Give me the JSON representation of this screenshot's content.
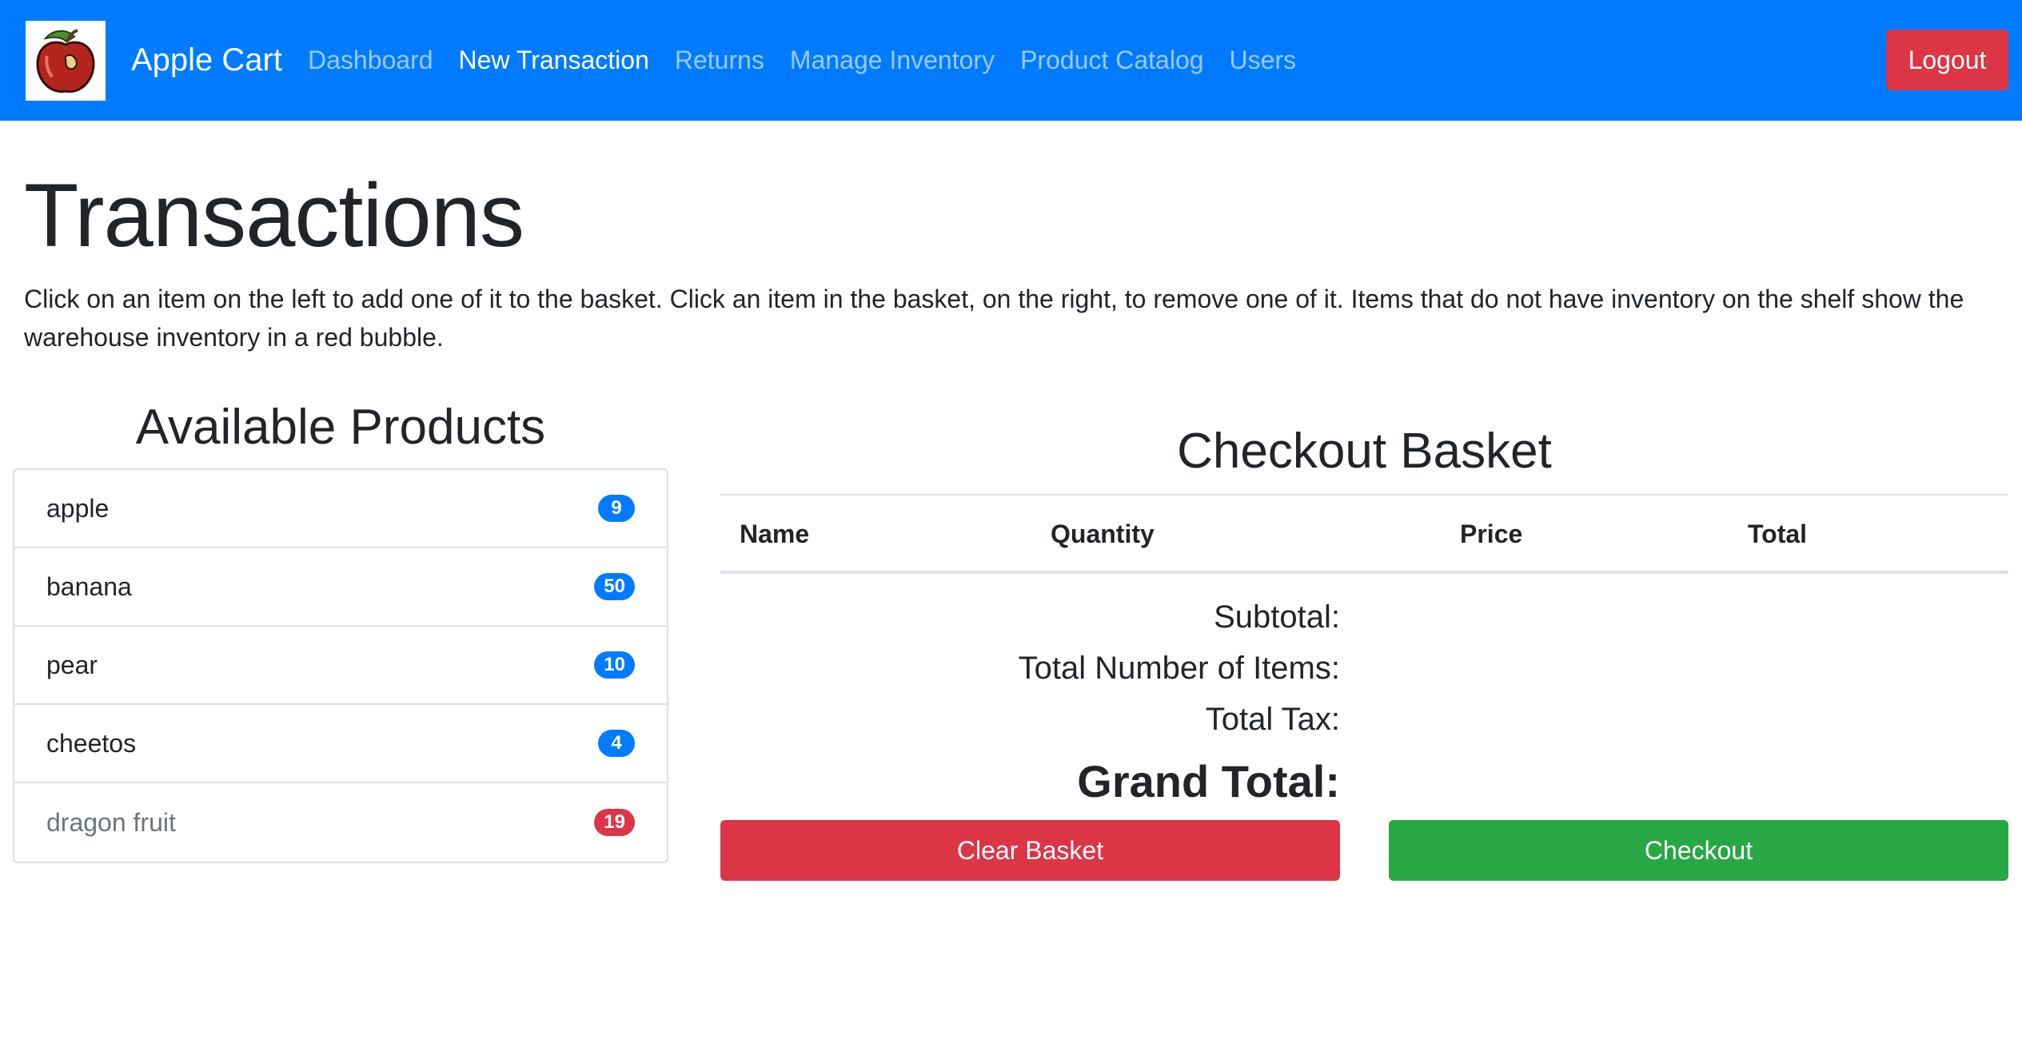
{
  "navbar": {
    "brand": "Apple Cart",
    "links": [
      "Dashboard",
      "New Transaction",
      "Returns",
      "Manage Inventory",
      "Product Catalog",
      "Users"
    ],
    "active": "New Transaction",
    "logout": "Logout",
    "color": "#007bff"
  },
  "page": {
    "title": "Transactions",
    "description": "Click on an item on the left to add one of it to the basket. Click an item in the basket, on the right, to remove one of it. Items that do not have inventory on the shelf show the warehouse inventory in a red bubble."
  },
  "products": {
    "title": "Available Products",
    "items": [
      {
        "name": "apple",
        "count": "9",
        "badge_color": "#007bff"
      },
      {
        "name": "banana",
        "count": "50",
        "badge_color": "#007bff"
      },
      {
        "name": "pear",
        "count": "10",
        "badge_color": "#007bff"
      },
      {
        "name": "cheetos",
        "count": "4",
        "badge_color": "#007bff"
      },
      {
        "name": "dragon fruit",
        "count": "19",
        "badge_color": "#dc3545"
      }
    ]
  },
  "basket": {
    "title": "Checkout Basket",
    "columns": [
      "Name",
      "Quantity",
      "Price",
      "Total"
    ],
    "subtotal_label": "Subtotal:",
    "items_label": "Total Number of Items:",
    "tax_label": "Total Tax:",
    "grand_total_label": "Grand Total:",
    "clear_label": "Clear Basket",
    "checkout_label": "Checkout"
  }
}
